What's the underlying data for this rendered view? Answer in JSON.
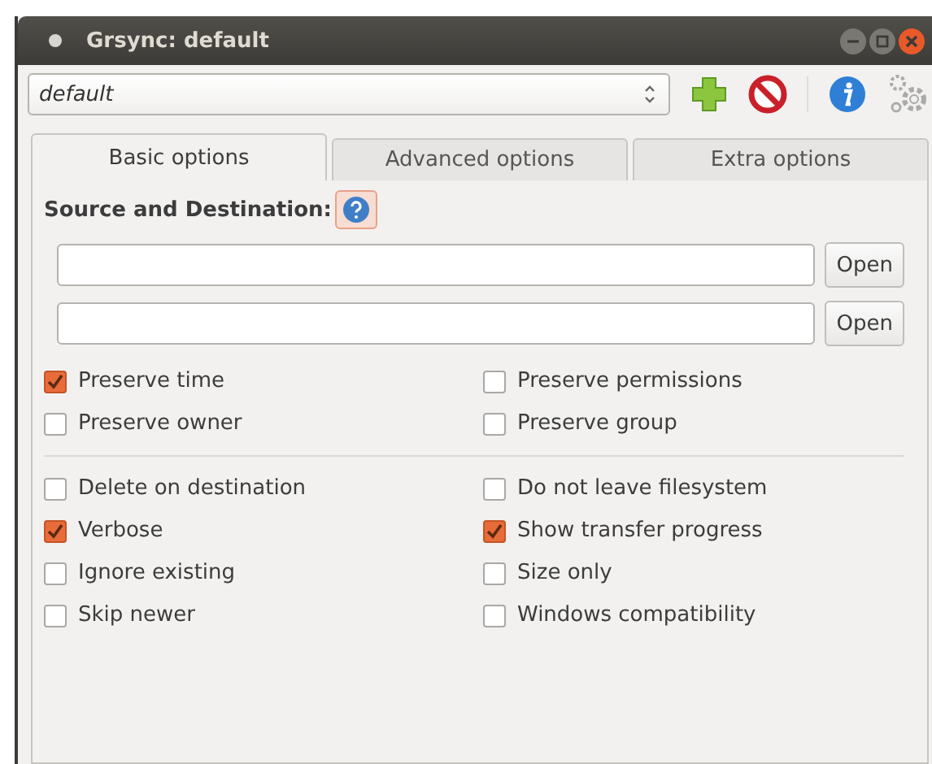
{
  "window": {
    "title": "Grsync: default"
  },
  "profile": {
    "value": "default"
  },
  "tabs": [
    {
      "label": "Basic options",
      "selected": true
    },
    {
      "label": "Advanced options",
      "selected": false
    },
    {
      "label": "Extra options",
      "selected": false
    }
  ],
  "section": {
    "label": "Source and Destination:"
  },
  "paths": [
    {
      "button": "Open"
    },
    {
      "button": "Open"
    }
  ],
  "option_groups": [
    {
      "options": [
        {
          "label": "Preserve time",
          "checked": true
        },
        {
          "label": "Preserve permissions",
          "checked": false
        },
        {
          "label": "Preserve owner",
          "checked": false
        },
        {
          "label": "Preserve group",
          "checked": false
        }
      ]
    },
    {
      "options": [
        {
          "label": "Delete on destination",
          "checked": false
        },
        {
          "label": "Do not leave filesystem",
          "checked": false
        },
        {
          "label": "Verbose",
          "checked": true
        },
        {
          "label": "Show transfer progress",
          "checked": true
        },
        {
          "label": "Ignore existing",
          "checked": false
        },
        {
          "label": "Size only",
          "checked": false
        },
        {
          "label": "Skip newer",
          "checked": false
        },
        {
          "label": "Windows compatibility",
          "checked": false
        }
      ]
    }
  ]
}
